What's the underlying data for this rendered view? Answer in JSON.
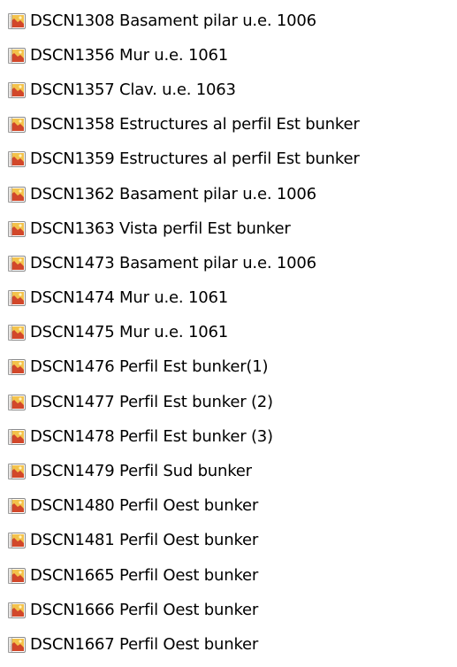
{
  "icon": "image-file-icon",
  "colors": {
    "text": "#000000",
    "background": "#ffffff",
    "icon_frame": "#8a8a8a",
    "icon_sky": "#f3c24b",
    "icon_ground": "#d2472a"
  },
  "files": [
    {
      "name": "DSCN1308 Basament pilar u.e. 1006"
    },
    {
      "name": "DSCN1356 Mur u.e. 1061"
    },
    {
      "name": "DSCN1357 Clav. u.e. 1063"
    },
    {
      "name": "DSCN1358 Estructures al perfil Est bunker"
    },
    {
      "name": "DSCN1359 Estructures al perfil Est bunker"
    },
    {
      "name": "DSCN1362 Basament pilar u.e. 1006"
    },
    {
      "name": "DSCN1363 Vista perfil Est bunker"
    },
    {
      "name": "DSCN1473 Basament pilar u.e. 1006"
    },
    {
      "name": "DSCN1474 Mur u.e. 1061"
    },
    {
      "name": "DSCN1475 Mur u.e. 1061"
    },
    {
      "name": "DSCN1476 Perfil Est bunker(1)"
    },
    {
      "name": "DSCN1477 Perfil Est bunker (2)"
    },
    {
      "name": "DSCN1478 Perfil Est bunker (3)"
    },
    {
      "name": "DSCN1479 Perfil Sud bunker"
    },
    {
      "name": "DSCN1480 Perfil Oest bunker"
    },
    {
      "name": "DSCN1481 Perfil Oest bunker"
    },
    {
      "name": "DSCN1665 Perfil Oest bunker"
    },
    {
      "name": "DSCN1666 Perfil Oest bunker"
    },
    {
      "name": "DSCN1667 Perfil Oest bunker"
    }
  ]
}
